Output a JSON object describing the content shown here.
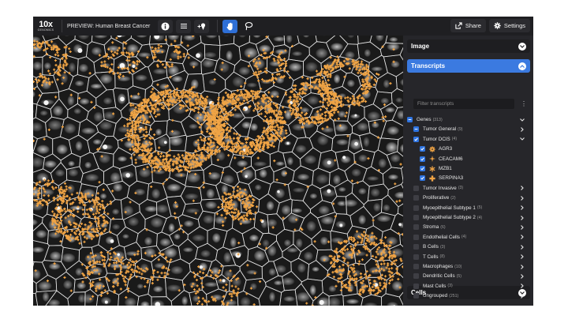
{
  "header": {
    "logo_main": "10x",
    "logo_sub": "GENOMICS",
    "title": "PREVIEW: Human Breast Cancer",
    "share_label": "Share",
    "settings_label": "Settings"
  },
  "panel": {
    "image_label": "Image",
    "transcripts_label": "Transcripts",
    "filter_placeholder": "Filter transcripts",
    "cells_label": "Cells",
    "genes": {
      "label": "Genes",
      "count": "(313)"
    },
    "groups": [
      {
        "label": "Tumor General",
        "count": "(9)",
        "state": "indeterminate",
        "expanded": false
      },
      {
        "label": "Tumor DCIS",
        "count": "(4)",
        "state": "checked",
        "expanded": true,
        "genes": [
          {
            "label": "AGR3",
            "icon": "gear-glyph",
            "checked": true
          },
          {
            "label": "CEACAM6",
            "icon": "sparkle-glyph",
            "checked": true
          },
          {
            "label": "MZB1",
            "icon": "asterisk-glyph",
            "checked": true
          },
          {
            "label": "SERPINA3",
            "icon": "plus-glyph",
            "checked": true
          }
        ]
      },
      {
        "label": "Tumor Invasive",
        "count": "(3)",
        "state": "unchecked"
      },
      {
        "label": "Proliferative",
        "count": "(2)",
        "state": "unchecked"
      },
      {
        "label": "Myoepithelial Subtype 1",
        "count": "(5)",
        "state": "unchecked"
      },
      {
        "label": "Myoepithelial Subtype 2",
        "count": "(4)",
        "state": "unchecked"
      },
      {
        "label": "Stroma",
        "count": "(6)",
        "state": "unchecked"
      },
      {
        "label": "Endothelial Cells",
        "count": "(4)",
        "state": "unchecked"
      },
      {
        "label": "B Cells",
        "count": "(3)",
        "state": "unchecked"
      },
      {
        "label": "T Cells",
        "count": "(8)",
        "state": "unchecked"
      },
      {
        "label": "Macrophages",
        "count": "(10)",
        "state": "unchecked"
      },
      {
        "label": "Dendritic Cells",
        "count": "(5)",
        "state": "unchecked"
      },
      {
        "label": "Mast Cells",
        "count": "(3)",
        "state": "unchecked"
      },
      {
        "label": "Ungrouped",
        "count": "(251)",
        "state": "unchecked"
      }
    ]
  },
  "colors": {
    "accent": "#2f74e0",
    "transcript_dot": "#f0a445",
    "panel_bg": "#26262a"
  }
}
